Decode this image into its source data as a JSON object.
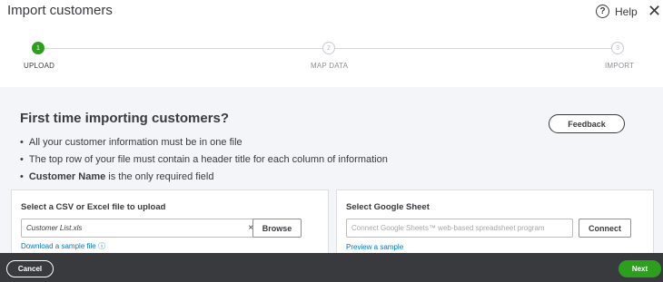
{
  "header": {
    "title": "Import customers",
    "help_label": "Help",
    "help_icon": "?",
    "close_icon": "✕"
  },
  "stepper": {
    "steps": [
      {
        "number": "1",
        "label": "UPLOAD",
        "state": "active"
      },
      {
        "number": "2",
        "label": "MAP DATA",
        "state": "inactive"
      },
      {
        "number": "3",
        "label": "IMPORT",
        "state": "inactive"
      }
    ]
  },
  "intro": {
    "heading": "First time importing customers?",
    "bullet_1": "All your customer information must be in one file",
    "bullet_2": "The top row of your file must contain a header title for each column of information",
    "bullet_3_bold": "Customer Name",
    "bullet_3_rest": " is the only required field",
    "feedback_label": "Feedback"
  },
  "file_panel": {
    "title": "Select a CSV or Excel file to upload",
    "file_value": "Customer List.xls",
    "clear_icon": "×",
    "browse_label": "Browse",
    "sample_link": "Download a sample file",
    "info_icon": "ⓘ"
  },
  "google_panel": {
    "title": "Select Google Sheet",
    "placeholder": "Connect Google Sheets™ web-based spreadsheet program",
    "connect_label": "Connect",
    "sample_link": "Preview a sample"
  },
  "footer": {
    "cancel_label": "Cancel",
    "next_label": "Next"
  },
  "colors": {
    "accent_green": "#2ca01c",
    "link_blue": "#0077c5",
    "footer_bg": "#393a3d"
  }
}
